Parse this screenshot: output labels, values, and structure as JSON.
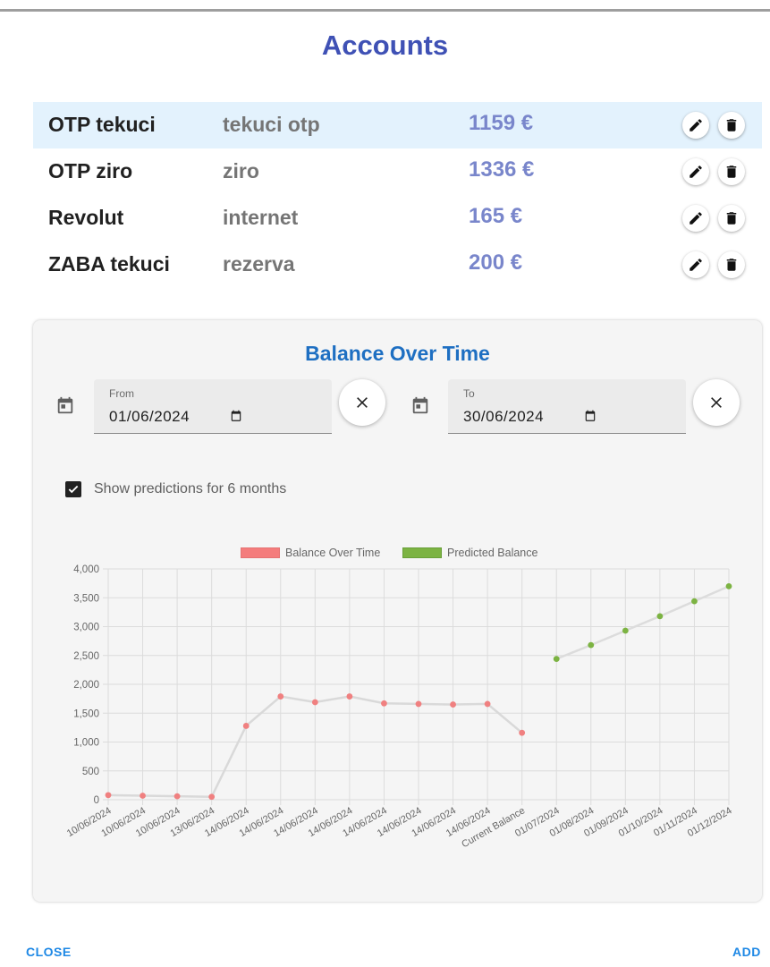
{
  "dialog": {
    "title": "Accounts"
  },
  "accounts": [
    {
      "name": "OTP tekuci",
      "description": "tekuci otp",
      "balance": "1159 €",
      "selected": true
    },
    {
      "name": "OTP ziro",
      "description": "ziro",
      "balance": "1336 €",
      "selected": false
    },
    {
      "name": "Revolut",
      "description": "internet",
      "balance": "165 €",
      "selected": false
    },
    {
      "name": "ZABA tekuci",
      "description": "rezerva",
      "balance": "200 €",
      "selected": false
    }
  ],
  "balance_card": {
    "title": "Balance Over Time",
    "from": {
      "label": "From",
      "value": "01/06/2024"
    },
    "to": {
      "label": "To",
      "value": "30/06/2024"
    },
    "predictions_checkbox": {
      "label": "Show predictions for 6 months",
      "checked": true
    }
  },
  "chart_data": {
    "type": "line",
    "categories": [
      "10/06/2024",
      "10/06/2024",
      "10/06/2024",
      "13/06/2024",
      "14/06/2024",
      "14/06/2024",
      "14/06/2024",
      "14/06/2024",
      "14/06/2024",
      "14/06/2024",
      "14/06/2024",
      "14/06/2024",
      "Current Balance",
      "01/07/2024",
      "01/08/2024",
      "01/09/2024",
      "01/10/2024",
      "01/11/2024",
      "01/12/2024"
    ],
    "series": [
      {
        "name": "Balance Over Time",
        "color": "#f08080",
        "values": [
          80,
          70,
          60,
          50,
          1280,
          1790,
          1690,
          1790,
          1670,
          1660,
          1650,
          1660,
          1160,
          null,
          null,
          null,
          null,
          null,
          null
        ]
      },
      {
        "name": "Predicted Balance",
        "color": "#7cb342",
        "values": [
          null,
          null,
          null,
          null,
          null,
          null,
          null,
          null,
          null,
          null,
          null,
          null,
          null,
          2440,
          2680,
          2930,
          3180,
          3440,
          3700
        ]
      }
    ],
    "yticks": [
      "4,000",
      "3,500",
      "3,000",
      "2,500",
      "2,000",
      "1,500",
      "1,000",
      "500",
      "0"
    ],
    "ylim": [
      0,
      4000
    ],
    "grid": true,
    "legend": "top"
  },
  "footer": {
    "close_label": "CLOSE",
    "add_label": "ADD"
  }
}
